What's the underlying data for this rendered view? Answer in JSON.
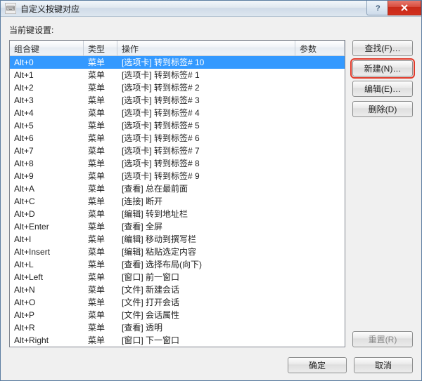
{
  "window": {
    "title": "自定义按键对应"
  },
  "labels": {
    "current_keys": "当前键设置:"
  },
  "columns": {
    "key": "组合键",
    "type": "类型",
    "op": "操作",
    "param": "参数"
  },
  "side_buttons": {
    "find": "查找(F)…",
    "new": "新建(N)…",
    "edit": "编辑(E)…",
    "delete": "删除(D)",
    "reset": "重置(R)"
  },
  "bottom_buttons": {
    "ok": "确定",
    "cancel": "取消"
  },
  "selected_index": 0,
  "rows": [
    {
      "key": "Alt+0",
      "type": "菜单",
      "op": "[选项卡] 转到标签# 10",
      "param": ""
    },
    {
      "key": "Alt+1",
      "type": "菜单",
      "op": "[选项卡] 转到标签# 1",
      "param": ""
    },
    {
      "key": "Alt+2",
      "type": "菜单",
      "op": "[选项卡] 转到标签# 2",
      "param": ""
    },
    {
      "key": "Alt+3",
      "type": "菜单",
      "op": "[选项卡] 转到标签# 3",
      "param": ""
    },
    {
      "key": "Alt+4",
      "type": "菜单",
      "op": "[选项卡] 转到标签# 4",
      "param": ""
    },
    {
      "key": "Alt+5",
      "type": "菜单",
      "op": "[选项卡] 转到标签# 5",
      "param": ""
    },
    {
      "key": "Alt+6",
      "type": "菜单",
      "op": "[选项卡] 转到标签# 6",
      "param": ""
    },
    {
      "key": "Alt+7",
      "type": "菜单",
      "op": "[选项卡] 转到标签# 7",
      "param": ""
    },
    {
      "key": "Alt+8",
      "type": "菜单",
      "op": "[选项卡] 转到标签# 8",
      "param": ""
    },
    {
      "key": "Alt+9",
      "type": "菜单",
      "op": "[选项卡] 转到标签# 9",
      "param": ""
    },
    {
      "key": "Alt+A",
      "type": "菜单",
      "op": "[查看] 总在最前面",
      "param": ""
    },
    {
      "key": "Alt+C",
      "type": "菜单",
      "op": "[连接] 断开",
      "param": ""
    },
    {
      "key": "Alt+D",
      "type": "菜单",
      "op": "[编辑] 转到地址栏",
      "param": ""
    },
    {
      "key": "Alt+Enter",
      "type": "菜单",
      "op": "[查看] 全屏",
      "param": ""
    },
    {
      "key": "Alt+I",
      "type": "菜单",
      "op": "[编辑] 移动到撰写栏",
      "param": ""
    },
    {
      "key": "Alt+Insert",
      "type": "菜单",
      "op": "[编辑] 粘贴选定内容",
      "param": ""
    },
    {
      "key": "Alt+L",
      "type": "菜单",
      "op": "[查看] 选择布局(向下)",
      "param": ""
    },
    {
      "key": "Alt+Left",
      "type": "菜单",
      "op": "[窗口] 前一窗口",
      "param": ""
    },
    {
      "key": "Alt+N",
      "type": "菜单",
      "op": "[文件] 新建会话",
      "param": ""
    },
    {
      "key": "Alt+O",
      "type": "菜单",
      "op": "[文件] 打开会话",
      "param": ""
    },
    {
      "key": "Alt+P",
      "type": "菜单",
      "op": "[文件] 会话属性",
      "param": ""
    },
    {
      "key": "Alt+R",
      "type": "菜单",
      "op": "[查看] 透明",
      "param": ""
    },
    {
      "key": "Alt+Right",
      "type": "菜单",
      "op": "[窗口] 下一窗口",
      "param": ""
    }
  ]
}
